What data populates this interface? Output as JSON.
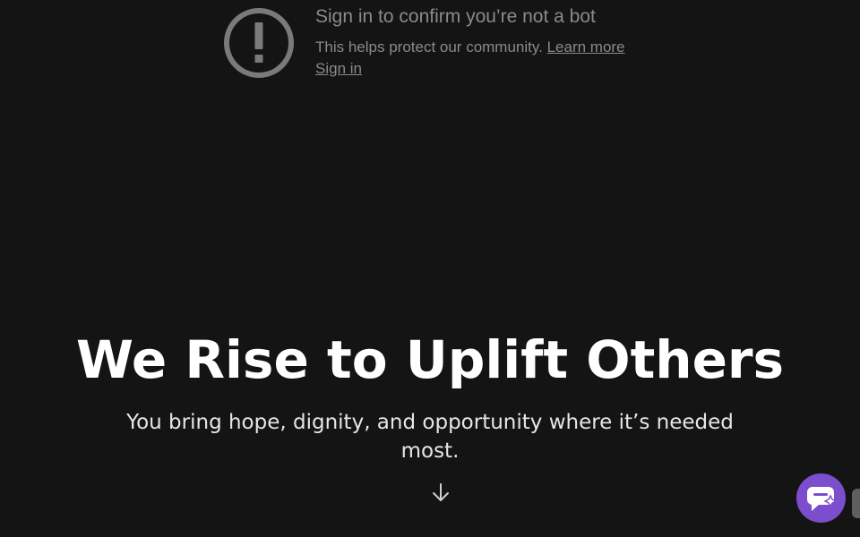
{
  "bot_notice": {
    "title": "Sign in to confirm you’re not a bot",
    "body": "This helps protect our community.",
    "learn_more_label": "Learn more",
    "sign_in_label": "Sign in",
    "icon": "exclamation-circle-icon"
  },
  "hero": {
    "title": "We Rise to Uplift Others",
    "subtitle": "You bring hope, dignity, and opportunity where it’s needed most."
  },
  "scroll": {
    "icon": "arrow-down-icon"
  },
  "chat": {
    "icon": "chat-icon",
    "color": "#7c4dcc"
  },
  "colors": {
    "background": "#151415",
    "notice_text": "#8a8a8a",
    "hero_text": "#ffffff"
  }
}
